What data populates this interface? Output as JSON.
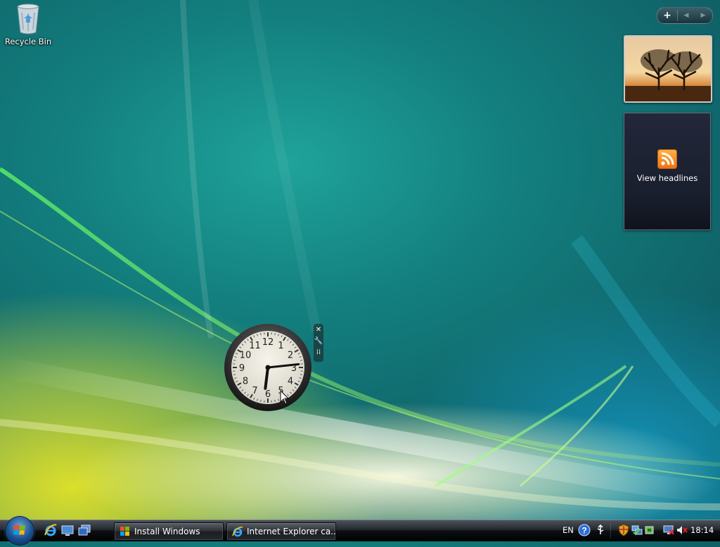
{
  "desktop": {
    "icons": [
      {
        "label": "Recycle Bin",
        "icon": "recycle-bin-icon"
      }
    ]
  },
  "sidebar": {
    "controls": {
      "add": "+",
      "prev": "◀",
      "next": "▶"
    },
    "feeds_gadget": {
      "label": "View headlines",
      "icon": "rss-icon"
    },
    "slideshow_gadget": {
      "image": "trees-at-sunset"
    }
  },
  "clock_gadget": {
    "time": "18:14",
    "numerals": [
      "12",
      "1",
      "2",
      "3",
      "4",
      "5",
      "6",
      "7",
      "8",
      "9",
      "10",
      "11"
    ],
    "tools": [
      "close-icon",
      "wrench-icon",
      "drag-grip-icon"
    ]
  },
  "taskbar": {
    "start_icon": "windows-start-orb-icon",
    "quick_launch": [
      "internet-explorer-icon",
      "show-desktop-icon",
      "switch-windows-icon"
    ],
    "buttons": [
      {
        "label": "Install Windows",
        "icon": "windows-logo-icon"
      },
      {
        "label": "Internet Explorer ca...",
        "icon": "internet-explorer-icon"
      }
    ],
    "tray": {
      "language": "EN",
      "icons": [
        "help-icon",
        "usb-icon",
        "security-shield-icon",
        "network-icon",
        "monitor-x-icon",
        "volume-muted-icon"
      ],
      "clock": "18:14"
    }
  },
  "colors": {
    "wallpaper_teal": "#137f7e",
    "wallpaper_yellow": "#e6e628",
    "taskbar": "#0d1014",
    "rss_orange": "#f07010"
  }
}
